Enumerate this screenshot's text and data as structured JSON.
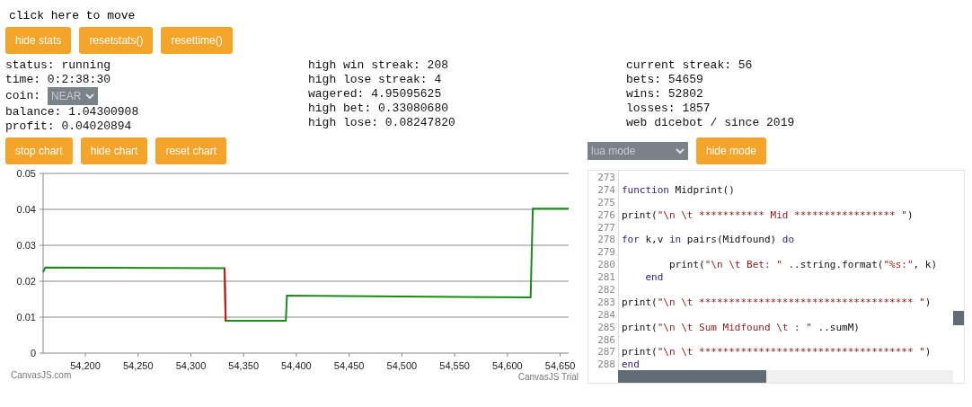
{
  "header": {
    "title": "click here to move"
  },
  "stat_buttons": [
    "hide stats",
    "resetstats()",
    "resettime()"
  ],
  "stats": [
    [
      {
        "kind": "text",
        "text": "status: running"
      },
      {
        "kind": "text",
        "text": "time: 0:2:38:30"
      },
      {
        "kind": "select",
        "label": "coin:",
        "value": "NEAR"
      },
      {
        "kind": "text",
        "text": "balance: 1.04300908"
      },
      {
        "kind": "text",
        "text": "profit: 0.04020894"
      }
    ],
    [
      {
        "kind": "text",
        "text": "high win streak: 208"
      },
      {
        "kind": "text",
        "text": "high lose streak: 4"
      },
      {
        "kind": "text",
        "text": "wagered: 4.95095625"
      },
      {
        "kind": "text",
        "text": "high bet: 0.33080680"
      },
      {
        "kind": "text",
        "text": "high lose: 0.08247820"
      }
    ],
    [
      {
        "kind": "text",
        "text": "current streak: 56"
      },
      {
        "kind": "text",
        "text": "bets: 54659"
      },
      {
        "kind": "text",
        "text": "wins: 52802"
      },
      {
        "kind": "text",
        "text": "losses: 1857"
      },
      {
        "kind": "text",
        "text": "web dicebot / since 2019"
      }
    ]
  ],
  "chart_buttons": [
    "stop chart",
    "hide chart",
    "reset chart"
  ],
  "chart": {
    "chart_data": {
      "type": "line",
      "x": [
        54160,
        54162,
        54332,
        54333,
        54390,
        54391,
        54622,
        54624,
        54658
      ],
      "xlim": [
        54160,
        54658
      ],
      "ylim": [
        0,
        0.05
      ],
      "grid": true,
      "xticks": [
        {
          "value": 54200,
          "label": "54,200"
        },
        {
          "value": 54250,
          "label": "54,250"
        },
        {
          "value": 54300,
          "label": "54,300"
        },
        {
          "value": 54350,
          "label": "54,350"
        },
        {
          "value": 54400,
          "label": "54,400"
        },
        {
          "value": 54450,
          "label": "54,450"
        },
        {
          "value": 54500,
          "label": "54,500"
        },
        {
          "value": 54550,
          "label": "54,550"
        },
        {
          "value": 54600,
          "label": "54,600"
        },
        {
          "value": 54650,
          "label": "54,650"
        }
      ],
      "yticks": [
        {
          "value": 0,
          "label": "0"
        },
        {
          "value": 0.01,
          "label": "0.01"
        },
        {
          "value": 0.02,
          "label": "0.02"
        },
        {
          "value": 0.03,
          "label": "0.03"
        },
        {
          "value": 0.04,
          "label": "0.04"
        },
        {
          "value": 0.05,
          "label": "0.05"
        }
      ],
      "series": [
        {
          "color": "#1a8a1a",
          "values": [
            0.0225,
            0.0238,
            0.0236,
            0.009,
            0.009,
            0.016,
            0.0155,
            0.0402,
            0.0402
          ]
        },
        {
          "color": "#e01010",
          "values": [
            null,
            null,
            0.0236,
            0.009,
            null,
            null,
            null,
            null,
            null
          ]
        }
      ]
    },
    "credit_left": "CanvasJS.com",
    "credit_right": "CanvasJS Trial"
  },
  "mode": {
    "select": "lua mode",
    "button": "hide mode"
  },
  "editor": {
    "lines": [
      {
        "number": "273"
      },
      {
        "number": "274",
        "tokens": [
          {
            "kind": "keyword",
            "text": "function"
          },
          {
            "kind": "plain",
            "text": " Midprint()"
          }
        ]
      },
      {
        "number": "275"
      },
      {
        "number": "276",
        "tokens": [
          {
            "kind": "plain",
            "text": "print("
          },
          {
            "kind": "string",
            "text": "\"\\n \\t *********** Mid ***************** \""
          },
          {
            "kind": "plain",
            "text": ")"
          }
        ]
      },
      {
        "number": "277"
      },
      {
        "number": "278",
        "tokens": [
          {
            "kind": "keyword",
            "text": "for"
          },
          {
            "kind": "plain",
            "text": " k,v "
          },
          {
            "kind": "keyword",
            "text": "in"
          },
          {
            "kind": "plain",
            "text": " pairs(Midfound) "
          },
          {
            "kind": "keyword",
            "text": "do"
          }
        ]
      },
      {
        "number": "279"
      },
      {
        "number": "280",
        "tokens": [
          {
            "kind": "plain",
            "text": "        print("
          },
          {
            "kind": "string",
            "text": "\"\\n \\t Bet: \""
          },
          {
            "kind": "plain",
            "text": " ..string.format("
          },
          {
            "kind": "string",
            "text": "\"%s:\""
          },
          {
            "kind": "plain",
            "text": ", k)"
          }
        ]
      },
      {
        "number": "281",
        "indented": true,
        "tokens": [
          {
            "kind": "keyword",
            "text": "end"
          }
        ]
      },
      {
        "number": "282"
      },
      {
        "number": "283",
        "tokens": [
          {
            "kind": "plain",
            "text": "print("
          },
          {
            "kind": "string",
            "text": "\"\\n \\t ************************************ \""
          },
          {
            "kind": "plain",
            "text": ")"
          }
        ]
      },
      {
        "number": "284"
      },
      {
        "number": "285",
        "tokens": [
          {
            "kind": "plain",
            "text": "print("
          },
          {
            "kind": "string",
            "text": "\"\\n \\t Sum Midfound \\t : \""
          },
          {
            "kind": "plain",
            "text": " ..sumM)"
          }
        ]
      },
      {
        "number": "286"
      },
      {
        "number": "287",
        "tokens": [
          {
            "kind": "plain",
            "text": "print("
          },
          {
            "kind": "string",
            "text": "\"\\n \\t ************************************ \""
          },
          {
            "kind": "plain",
            "text": ")"
          }
        ]
      },
      {
        "number": "288",
        "tokens": [
          {
            "kind": "keyword",
            "text": "end"
          }
        ]
      }
    ]
  }
}
